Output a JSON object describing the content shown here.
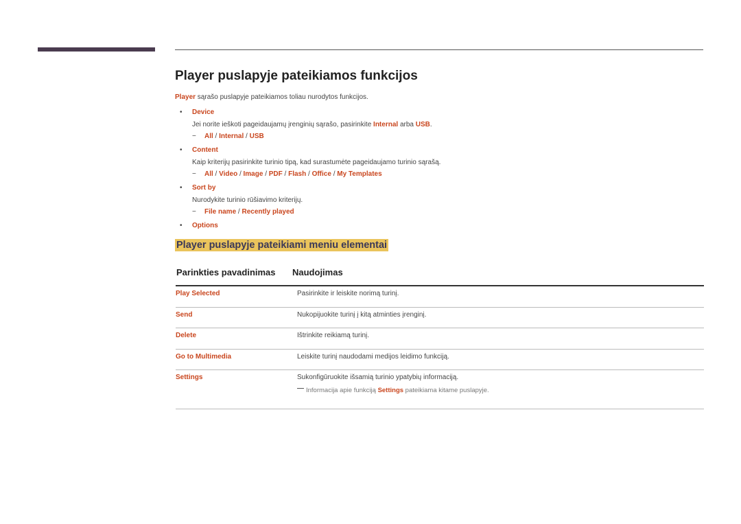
{
  "title": "Player puslapyje pateikiamos funkcijos",
  "intro": {
    "lead": "Player",
    "text": " sąrašo puslapyje pateikiamos toliau nurodytos funkcijos."
  },
  "items": [
    {
      "label": "Device",
      "desc_pre": "Jei norite ieškoti pageidaujamų įrenginių sąrašo, pasirinkite ",
      "desc_k1": "Internal",
      "desc_mid": " arba ",
      "desc_k2": "USB",
      "desc_post": ".",
      "options": [
        "All",
        "Internal",
        "USB"
      ]
    },
    {
      "label": "Content",
      "desc": "Kaip kriterijų pasirinkite turinio tipą, kad surastumėte pageidaujamo turinio sąrašą.",
      "options": [
        "All",
        "Video",
        "Image",
        "PDF",
        "Flash",
        "Office",
        "My Templates"
      ]
    },
    {
      "label": "Sort by",
      "desc": "Nurodykite turinio rūšiavimo kriterijų.",
      "options": [
        "File name",
        "Recently played"
      ]
    },
    {
      "label": "Options"
    }
  ],
  "section_title": "Player puslapyje pateikiami meniu elementai",
  "table": {
    "headers": [
      "Parinkties pavadinimas",
      "Naudojimas"
    ],
    "rows": [
      {
        "name": "Play Selected",
        "use": "Pasirinkite ir leiskite norimą turinį."
      },
      {
        "name": "Send",
        "use": "Nukopijuokite turinį į kitą atminties įrenginį."
      },
      {
        "name": "Delete",
        "use": "Ištrinkite reikiamą turinį."
      },
      {
        "name": "Go to Multimedia",
        "use": "Leiskite turinį naudodami medijos leidimo funkciją."
      },
      {
        "name": "Settings",
        "use": "Sukonfigūruokite išsamią turinio ypatybių informaciją.",
        "note_pre": "Informacija apie funkciją ",
        "note_key": "Settings",
        "note_post": " pateikiama kitame puslapyje."
      }
    ]
  },
  "colors": {
    "accent": "#c9461e",
    "highlight": "#eac45c",
    "bar": "#4a3b4f"
  }
}
